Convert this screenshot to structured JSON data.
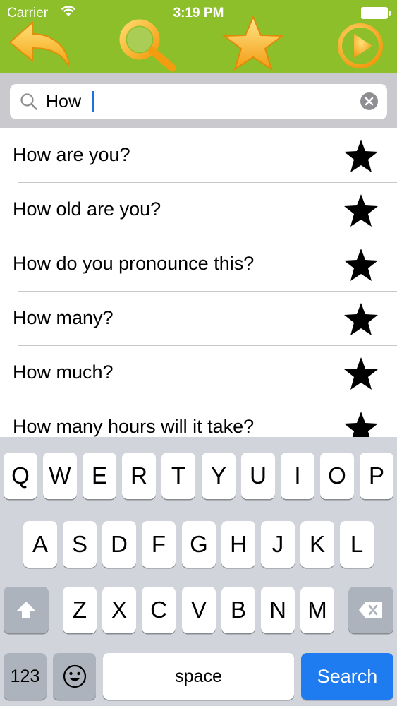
{
  "status_bar": {
    "carrier": "Carrier",
    "time": "3:19 PM"
  },
  "toolbar": {
    "icons": [
      "back-arrow-icon",
      "search-icon",
      "star-icon",
      "play-icon"
    ],
    "colors": {
      "background": "#8dbf2a",
      "icon_fill": "#f5b21b"
    }
  },
  "search": {
    "value": "How",
    "clear_icon": "clear-icon"
  },
  "list": {
    "items": [
      {
        "label": "How are you?",
        "icon": "star-icon"
      },
      {
        "label": "How old are you?",
        "icon": "star-icon"
      },
      {
        "label": "How do you pronounce this?",
        "icon": "star-icon"
      },
      {
        "label": "How many?",
        "icon": "star-icon"
      },
      {
        "label": "How much?",
        "icon": "star-icon"
      },
      {
        "label": "How many hours will it take?",
        "icon": "star-icon"
      }
    ]
  },
  "keyboard": {
    "row1": [
      "Q",
      "W",
      "E",
      "R",
      "T",
      "Y",
      "U",
      "I",
      "O",
      "P"
    ],
    "row2": [
      "A",
      "S",
      "D",
      "F",
      "G",
      "H",
      "J",
      "K",
      "L"
    ],
    "row3": [
      "Z",
      "X",
      "C",
      "V",
      "B",
      "N",
      "M"
    ],
    "shift_icon": "shift-icon",
    "delete_icon": "delete-icon",
    "numbers_label": "123",
    "emoji_icon": "emoji-icon",
    "space_label": "space",
    "search_label": "Search",
    "search_key_color": "#1f7cf0"
  }
}
